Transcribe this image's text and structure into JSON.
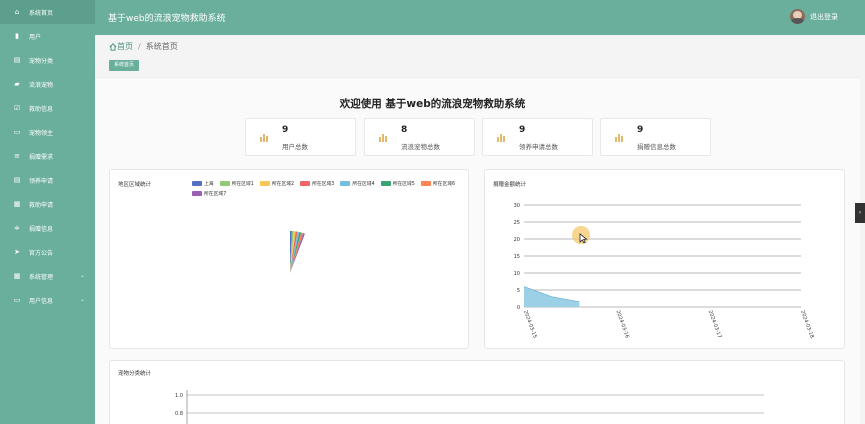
{
  "app": {
    "title": "基于web的流浪宠物救助系统",
    "logout": "退出登录"
  },
  "sidebar": {
    "items": [
      {
        "label": "系统首页",
        "icon": "home-icon"
      },
      {
        "label": "用户",
        "icon": "bar-chart-icon"
      },
      {
        "label": "宠物分类",
        "icon": "clipboard-icon"
      },
      {
        "label": "流浪宠物",
        "icon": "car-icon"
      },
      {
        "label": "救助信息",
        "icon": "check-square-icon"
      },
      {
        "label": "宠物领主",
        "icon": "desktop-icon"
      },
      {
        "label": "捐赠需求",
        "icon": "list-icon"
      },
      {
        "label": "领养申请",
        "icon": "clipboard-icon"
      },
      {
        "label": "救助申请",
        "icon": "grid-icon"
      },
      {
        "label": "捐赠信息",
        "icon": "sliders-icon"
      },
      {
        "label": "官方公告",
        "icon": "send-icon"
      },
      {
        "label": "系统管理",
        "icon": "grid-icon",
        "chevron": "⌄"
      },
      {
        "label": "用户信息",
        "icon": "desktop-icon",
        "chevron": "⌄"
      }
    ]
  },
  "breadcrumb": {
    "home": "首页",
    "sep": "/",
    "current": "系统首页"
  },
  "tab": {
    "label": "系统首页"
  },
  "welcome": "欢迎使用 基于web的流浪宠物救助系统",
  "stats": [
    {
      "value": "9",
      "label": "用户总数"
    },
    {
      "value": "8",
      "label": "流浪宠物总数"
    },
    {
      "value": "9",
      "label": "领养申请总数"
    },
    {
      "value": "9",
      "label": "捐赠信息总数"
    }
  ],
  "pie_panel": {
    "title": "地区区域统计",
    "legend": [
      {
        "name": "上海",
        "color": "#5470c6"
      },
      {
        "name": "所在区域1",
        "color": "#91cc75"
      },
      {
        "name": "所在区域2",
        "color": "#fac858"
      },
      {
        "name": "所在区域3",
        "color": "#ee6666"
      },
      {
        "name": "所在区域4",
        "color": "#73c0de"
      },
      {
        "name": "所在区域5",
        "color": "#3ba272"
      },
      {
        "name": "所在区域6",
        "color": "#fc8452"
      },
      {
        "name": "所在区域7",
        "color": "#9a60b4"
      }
    ]
  },
  "line_panel": {
    "title": "捐赠金额统计"
  },
  "bottom_panel": {
    "title": "宠物分类统计"
  },
  "chart_data": [
    {
      "type": "area",
      "title": "捐赠金额统计",
      "ylim": [
        0,
        30
      ],
      "yticks": [
        "0",
        "5",
        "10",
        "15",
        "20",
        "25",
        "30"
      ],
      "categories": [
        "2024-03-15",
        "2024-03-16",
        "2024-03-17",
        "2024-03-18"
      ],
      "x": [
        "2024-03-15",
        "2024-03-15",
        "2024-03-16"
      ],
      "xpos": [
        0,
        0.25,
        0.5
      ],
      "values": [
        6,
        3,
        1.5
      ],
      "color": "#9cd0e6",
      "stroke": "#6fb4d6",
      "grid": true
    },
    {
      "type": "bar",
      "title": "宠物分类统计",
      "ylim": [
        0,
        1
      ],
      "yticks": [
        "0.8",
        "1.0"
      ],
      "categories": [],
      "values": []
    }
  ]
}
